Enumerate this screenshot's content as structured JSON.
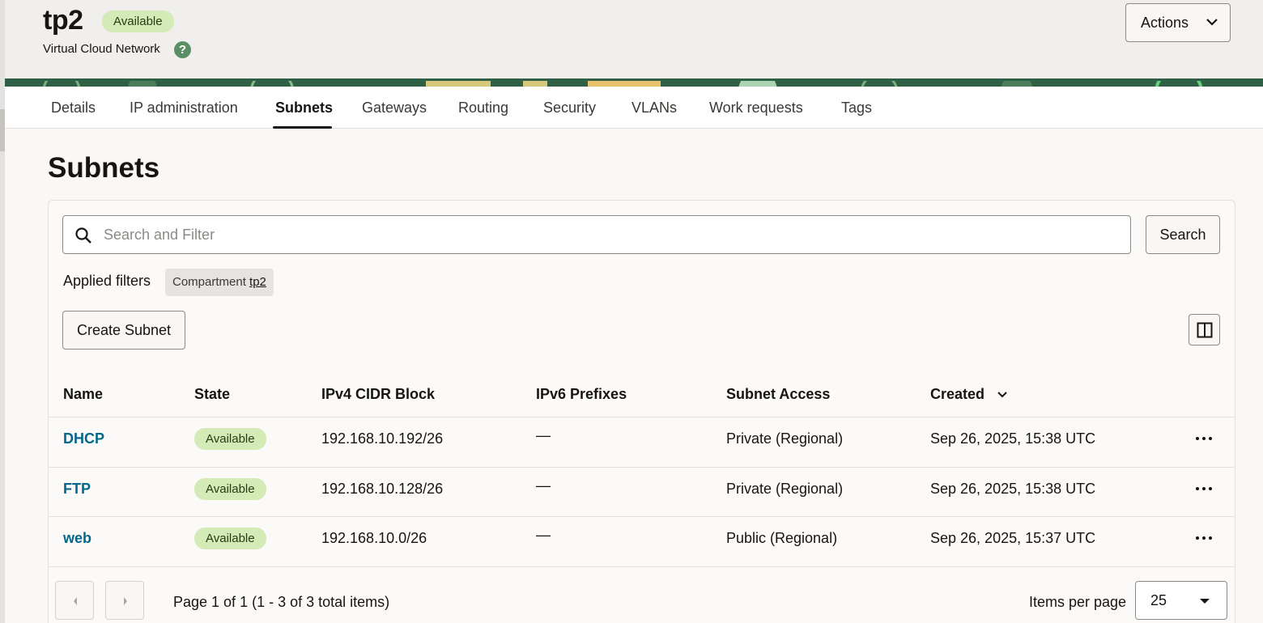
{
  "header": {
    "title": "tp2",
    "status": "Available",
    "subtitle": "Virtual Cloud Network",
    "help_glyph": "?",
    "actions_label": "Actions"
  },
  "tabs": [
    {
      "label": "Details"
    },
    {
      "label": "IP administration"
    },
    {
      "label": "Subnets",
      "active": true
    },
    {
      "label": "Gateways"
    },
    {
      "label": "Routing"
    },
    {
      "label": "Security"
    },
    {
      "label": "VLANs"
    },
    {
      "label": "Work requests"
    },
    {
      "label": "Tags"
    }
  ],
  "section": {
    "title": "Subnets"
  },
  "search": {
    "placeholder": "Search and Filter",
    "value": "",
    "button_label": "Search"
  },
  "filters": {
    "label": "Applied filters",
    "chip_key": "Compartment",
    "chip_value": "tp2"
  },
  "toolbar": {
    "create_label": "Create Subnet"
  },
  "table": {
    "columns": [
      "Name",
      "State",
      "IPv4 CIDR Block",
      "IPv6 Prefixes",
      "Subnet Access",
      "Created"
    ],
    "rows": [
      {
        "name": "DHCP",
        "state": "Available",
        "ipv4": "192.168.10.192/26",
        "ipv6": "—",
        "access": "Private (Regional)",
        "created": "Sep 26, 2025, 15:38 UTC"
      },
      {
        "name": "FTP",
        "state": "Available",
        "ipv4": "192.168.10.128/26",
        "ipv6": "—",
        "access": "Private (Regional)",
        "created": "Sep 26, 2025, 15:38 UTC"
      },
      {
        "name": "web",
        "state": "Available",
        "ipv4": "192.168.10.0/26",
        "ipv6": "—",
        "access": "Public (Regional)",
        "created": "Sep 26, 2025, 15:37 UTC"
      }
    ]
  },
  "pagination": {
    "summary": "Page 1 of 1 (1 - 3 of 3 total items)",
    "items_per_page_label": "Items per page",
    "items_per_page": "25"
  },
  "colors": {
    "badge_bg": "#d4ebb8",
    "link": "#00688c",
    "help_icon": "#5a8f66",
    "banner": "#2f5f45"
  }
}
